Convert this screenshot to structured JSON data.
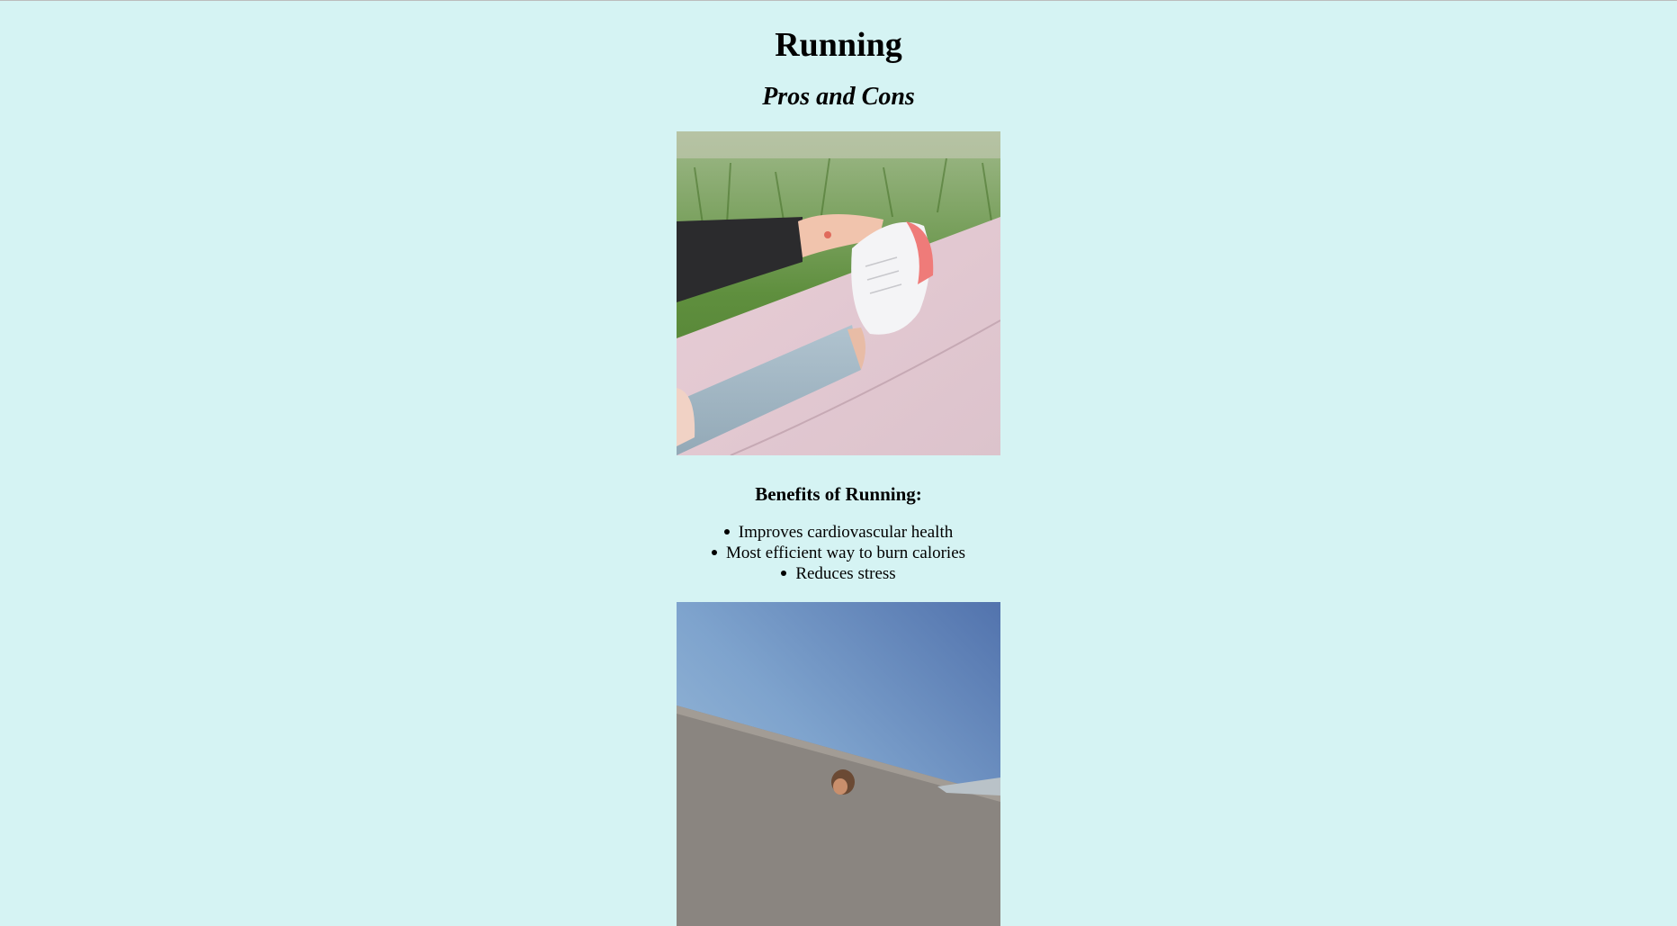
{
  "page": {
    "title": "Running",
    "subtitle": "Pros and Cons"
  },
  "images": [
    {
      "name": "stretching-photo",
      "description_icon": "image-icon"
    },
    {
      "name": "running-stairs-photo",
      "description_icon": "image-icon"
    }
  ],
  "benefits": {
    "heading": "Benefits of Running:",
    "items": [
      "Improves cardiovascular health",
      "Most efficient way to burn calories",
      "Reduces stress"
    ]
  },
  "colors": {
    "background": "#d5f3f3",
    "text": "#000000"
  }
}
